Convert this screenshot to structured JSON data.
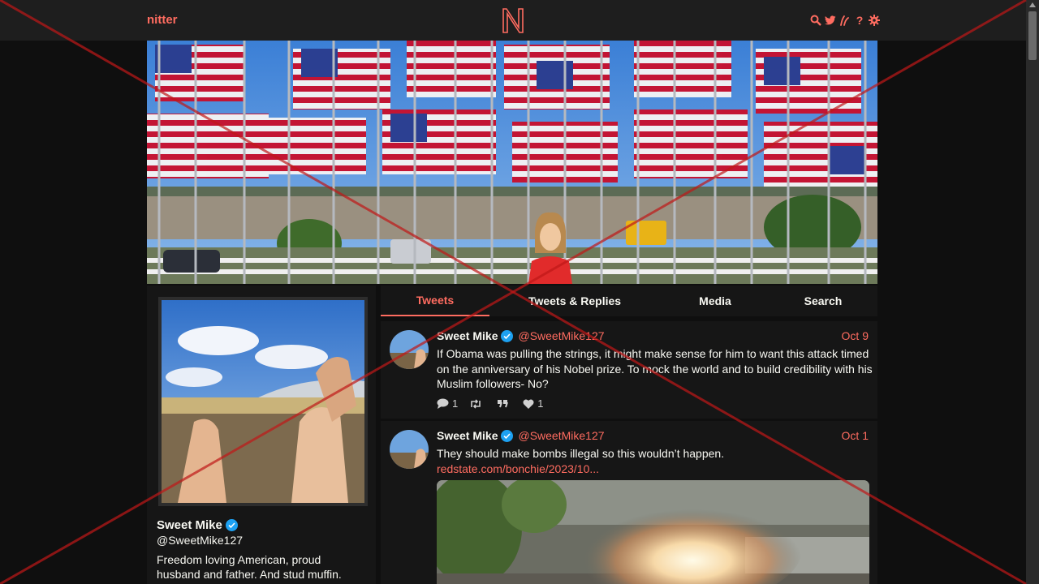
{
  "navbar": {
    "brand": "nitter",
    "logo_letter": "N",
    "icons": [
      "search-icon",
      "twitter-icon",
      "rss-icon",
      "help-icon",
      "gear-icon"
    ],
    "help_glyph": "?"
  },
  "colors": {
    "accent": "#ff6c60",
    "background": "#0f0f0f",
    "panel": "#161616",
    "navbar": "#1e1e1e",
    "verified": "#1da1f2",
    "overlay_cross": "#c01818"
  },
  "profile": {
    "name": "Sweet Mike",
    "handle": "@SweetMike127",
    "bio": "Freedom loving American, proud husband and father. And stud muffin."
  },
  "tabs": [
    {
      "label": "Tweets",
      "active": true
    },
    {
      "label": "Tweets & Replies",
      "active": false
    },
    {
      "label": "Media",
      "active": false
    },
    {
      "label": "Search",
      "active": false
    }
  ],
  "tweets": [
    {
      "name": "Sweet Mike",
      "handle": "@SweetMike127",
      "date": "Oct 9",
      "text": "If Obama was pulling the strings, it might make sense for him to want this attack timed on the anniversary of his Nobel prize. To mock the world and to build credibility with his Muslim followers- No?",
      "replies": "1",
      "retweets": "",
      "quotes": "",
      "likes": "1"
    },
    {
      "name": "Sweet Mike",
      "handle": "@SweetMike127",
      "date": "Oct 1",
      "text": "They should make bombs illegal so this wouldn’t happen.",
      "link": "redstate.com/bonchie/2023/10..."
    }
  ]
}
